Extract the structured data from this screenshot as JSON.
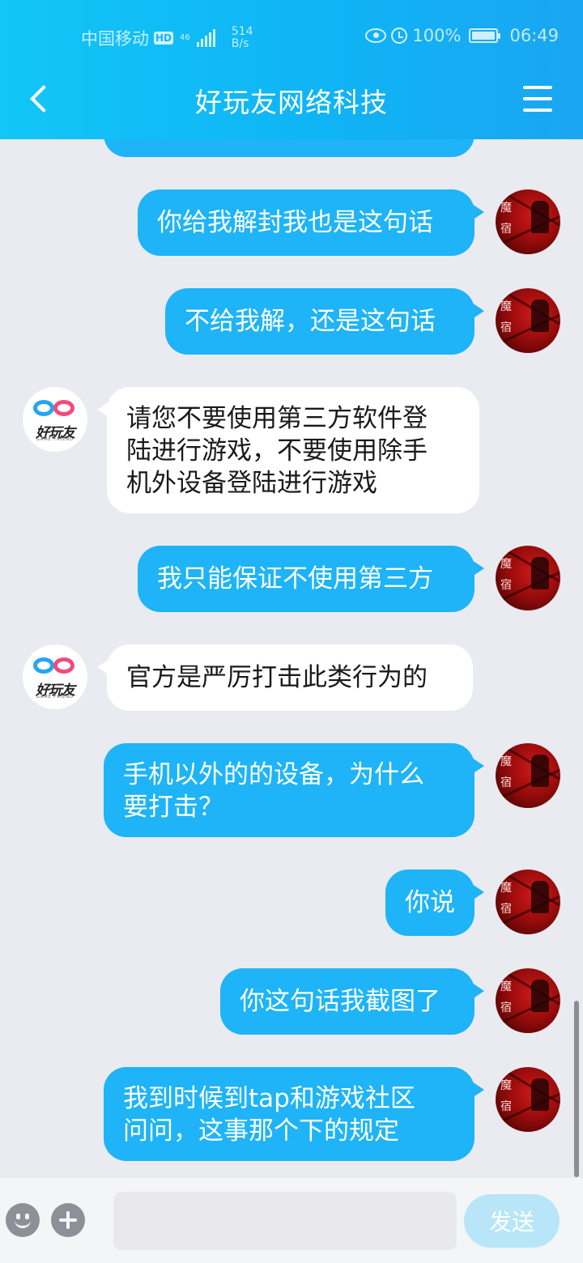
{
  "status_bar": {
    "carrier": "中国移动",
    "hd": "HD",
    "network": "46",
    "speed_value": "514",
    "speed_unit": "B/s",
    "battery": "100%",
    "time": "06:49"
  },
  "header": {
    "title": "好玩友网络科技"
  },
  "bot_avatar": {
    "logo_text": "好玩友",
    "logo_sub": "GAME FRIEND"
  },
  "user_avatar": {
    "char1": "魔",
    "char2": "宿"
  },
  "messages": [
    {
      "side": "out",
      "text": "你给我解封我也是这句话"
    },
    {
      "side": "out",
      "text": "不给我解，还是这句话"
    },
    {
      "side": "in",
      "lines": [
        "请您不要使用第三方软件登",
        "陆进行游戏，不要使用除手",
        "机外设备登陆进行游戏"
      ]
    },
    {
      "side": "out",
      "text": "我只能保证不使用第三方"
    },
    {
      "side": "in",
      "text": "官方是严厉打击此类行为的"
    },
    {
      "side": "out",
      "lines": [
        "手机以外的的设备，为什么",
        "要打击？"
      ]
    },
    {
      "side": "out",
      "text": "你说"
    },
    {
      "side": "out",
      "text": "你这句话我截图了"
    },
    {
      "side": "out",
      "lines": [
        "我到时候到tap和游戏社区",
        "问问，这事那个下的规定"
      ]
    }
  ],
  "input": {
    "value": "",
    "placeholder": ""
  },
  "send_label": "发送"
}
